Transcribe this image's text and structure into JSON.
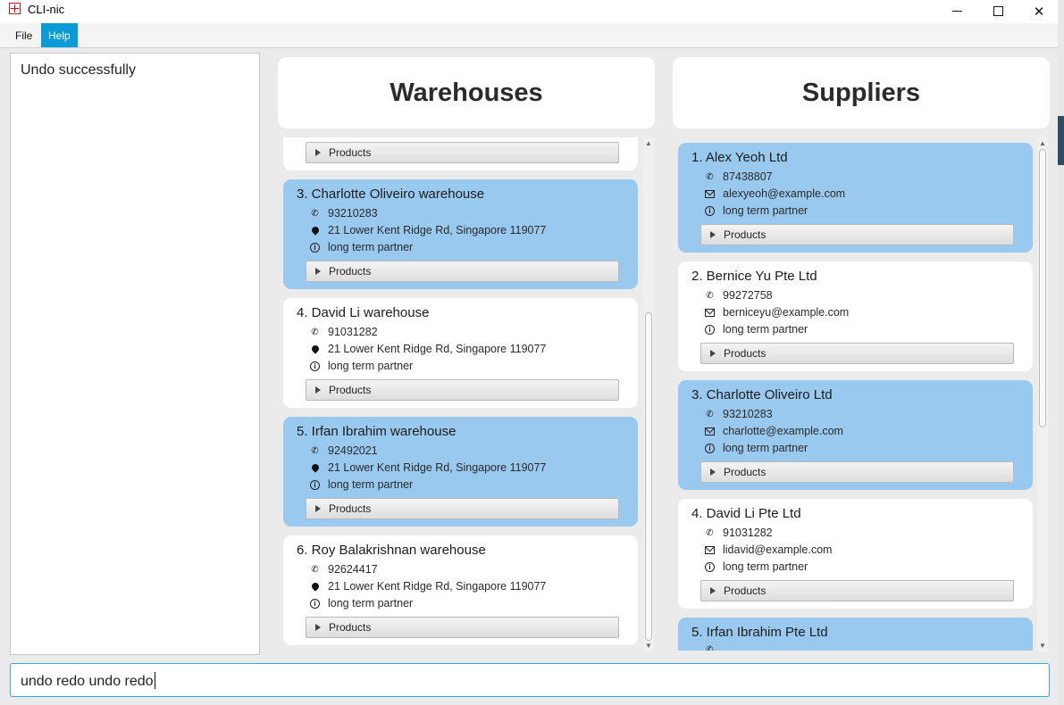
{
  "window": {
    "title": "CLI-nic"
  },
  "menu": {
    "file": "File",
    "help": "Help"
  },
  "result": {
    "text": "Undo successfully"
  },
  "command": {
    "value": "undo redo undo redo"
  },
  "warehouses": {
    "title": "Warehouses",
    "partial_product_label": "Products",
    "items": [
      {
        "title": "3.  Charlotte Oliveiro warehouse",
        "phone": "93210283",
        "address": "21 Lower Kent Ridge Rd, Singapore 119077",
        "remark": "long term partner",
        "products": "Products",
        "highlight": true
      },
      {
        "title": "4.  David Li warehouse",
        "phone": "91031282",
        "address": "21 Lower Kent Ridge Rd, Singapore 119077",
        "remark": "long term partner",
        "products": "Products",
        "highlight": false
      },
      {
        "title": "5.  Irfan Ibrahim warehouse",
        "phone": "92492021",
        "address": "21 Lower Kent Ridge Rd, Singapore 119077",
        "remark": "long term partner",
        "products": "Products",
        "highlight": true
      },
      {
        "title": "6.  Roy Balakrishnan warehouse",
        "phone": "92624417",
        "address": "21 Lower Kent Ridge Rd, Singapore 119077",
        "remark": "long term partner",
        "products": "Products",
        "highlight": false
      }
    ]
  },
  "suppliers": {
    "title": "Suppliers",
    "items": [
      {
        "title": "1.  Alex Yeoh Ltd",
        "phone": "87438807",
        "email": "alexyeoh@example.com",
        "remark": "long term partner",
        "products": "Products",
        "highlight": true
      },
      {
        "title": "2.  Bernice Yu Pte Ltd",
        "phone": "99272758",
        "email": "berniceyu@example.com",
        "remark": "long term partner",
        "products": "Products",
        "highlight": false
      },
      {
        "title": "3.  Charlotte Oliveiro Ltd",
        "phone": "93210283",
        "email": "charlotte@example.com",
        "remark": "long term partner",
        "products": "Products",
        "highlight": true
      },
      {
        "title": "4.  David Li Pte Ltd",
        "phone": "91031282",
        "email": "lidavid@example.com",
        "remark": "long term partner",
        "products": "Products",
        "highlight": false
      },
      {
        "title": "5.  Irfan Ibrahim Pte Ltd",
        "highlight": true
      }
    ]
  },
  "colors": {
    "highlight_card": "#99c9ee",
    "menu_active": "#0a9bd6",
    "command_border": "#3aa8d8"
  },
  "icons": {
    "phone": "phone-icon",
    "address": "location-pin-icon",
    "email": "envelope-icon",
    "remark": "info-icon",
    "expand": "triangle-right-icon"
  }
}
